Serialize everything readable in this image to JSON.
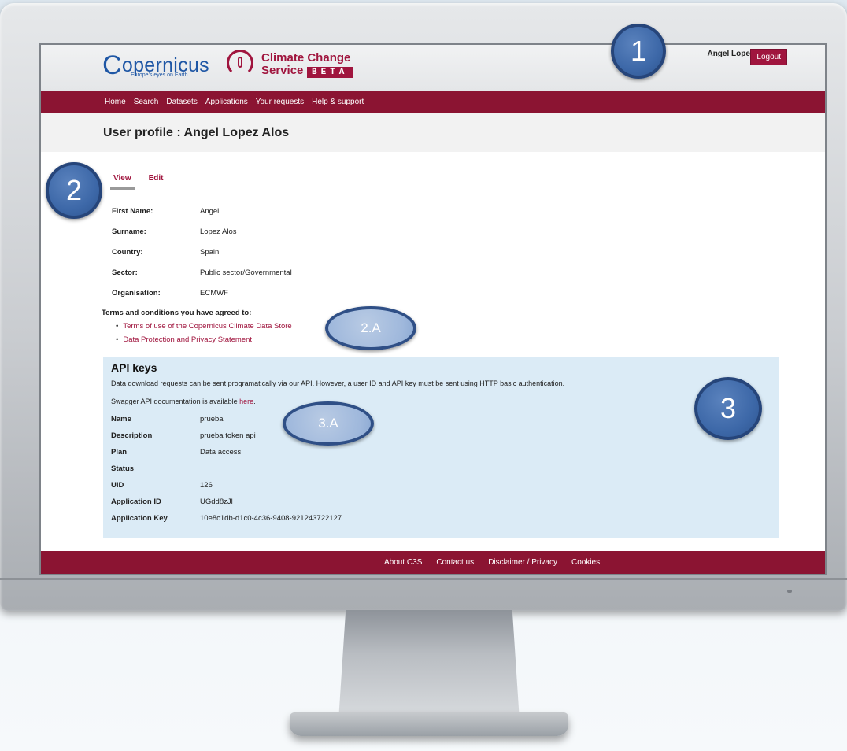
{
  "header": {
    "copernicus_logo": {
      "name": "opernicus",
      "initial": "C",
      "tagline": "Europe's eyes on Earth"
    },
    "c3s_logo": {
      "line1": "Climate Change",
      "line2": "Service",
      "beta": "BETA"
    },
    "user_name": "Angel Lopez Alos",
    "logout_label": "Logout"
  },
  "nav": {
    "items": [
      "Home",
      "Search",
      "Datasets",
      "Applications",
      "Your requests",
      "Help & support"
    ]
  },
  "page_title": "User profile : Angel Lopez Alos",
  "tabs": [
    {
      "label": "View",
      "active": true
    },
    {
      "label": "Edit",
      "active": false
    }
  ],
  "profile": {
    "fields": [
      {
        "label": "First Name:",
        "value": "Angel"
      },
      {
        "label": "Surname:",
        "value": "Lopez Alos"
      },
      {
        "label": "Country:",
        "value": "Spain"
      },
      {
        "label": "Sector:",
        "value": "Public sector/Governmental"
      },
      {
        "label": "Organisation:",
        "value": "ECMWF"
      }
    ]
  },
  "terms": {
    "heading": "Terms and conditions you have agreed to:",
    "items": [
      "Terms of use of the Copernicus Climate Data Store",
      "Data Protection and Privacy Statement"
    ]
  },
  "api": {
    "title": "API keys",
    "description": "Data download requests can be sent programatically via our API. However, a user ID and API key must be sent using HTTP basic authentication.",
    "swagger_prefix": "Swagger API documentation is available ",
    "swagger_link": "here",
    "swagger_suffix": ".",
    "rows": [
      {
        "label": "Name",
        "value": "prueba"
      },
      {
        "label": "Description",
        "value": "prueba token api"
      },
      {
        "label": "Plan",
        "value": "Data access"
      },
      {
        "label": "Status",
        "value": ""
      },
      {
        "label": "UID",
        "value": "126"
      },
      {
        "label": "Application ID",
        "value": "UGdd8zJl"
      },
      {
        "label": "Application Key",
        "value": "10e8c1db-d1c0-4c36-9408-921243722127"
      }
    ]
  },
  "footer": {
    "items": [
      "About C3S",
      "Contact us",
      "Disclaimer / Privacy",
      "Cookies"
    ]
  },
  "callouts": [
    "1",
    "2",
    "2.A",
    "3",
    "3.A"
  ],
  "colors": {
    "brand": "#8b1432",
    "accent_link": "#a0153e",
    "api_box": "#dbebf6",
    "callout": "#3d68a8"
  }
}
